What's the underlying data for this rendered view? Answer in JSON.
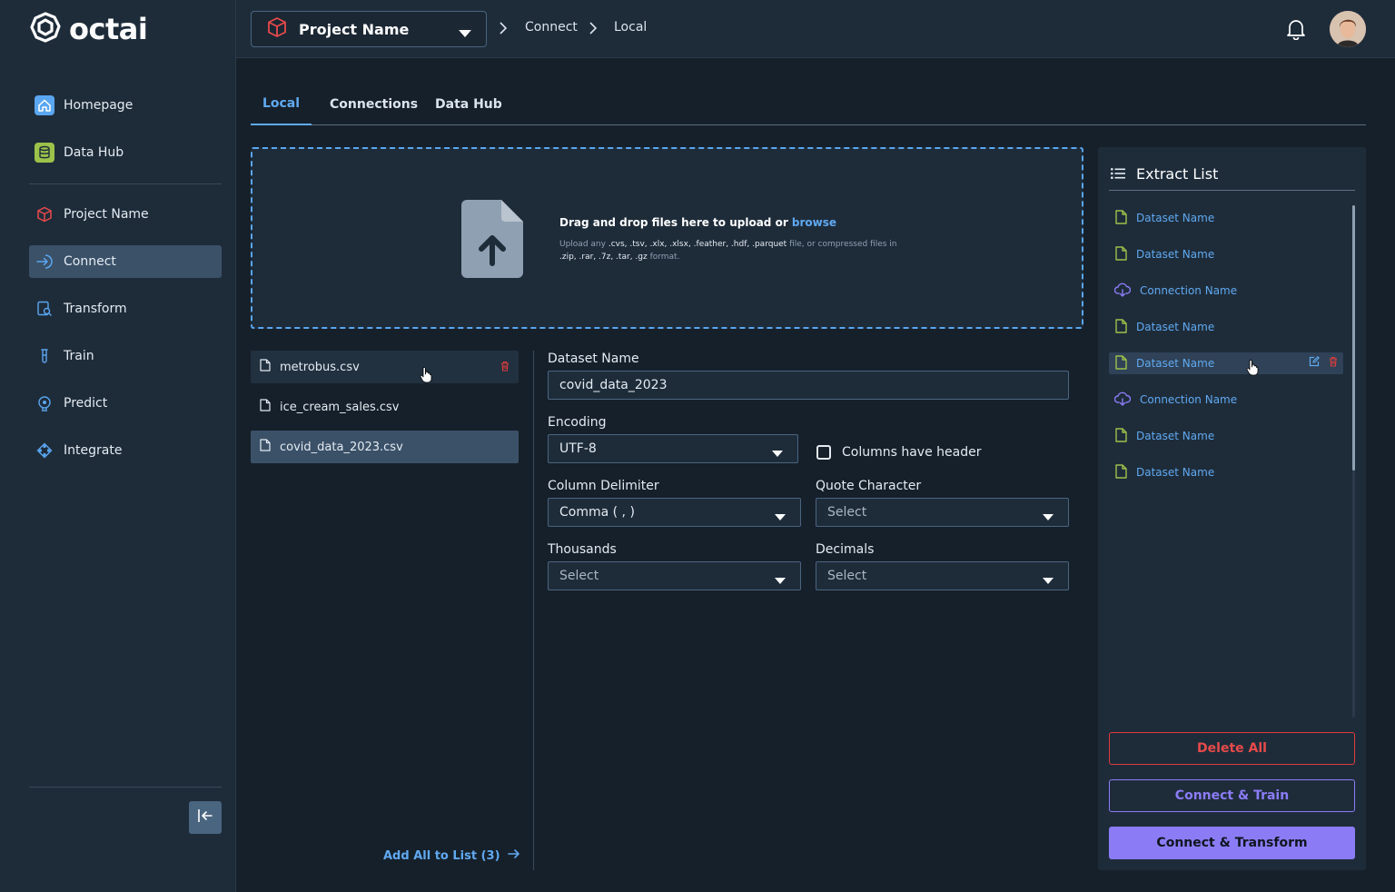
{
  "app": {
    "logo_text": "octai"
  },
  "sidebar": {
    "items": [
      {
        "label": "Homepage",
        "icon": "home-icon"
      },
      {
        "label": "Data Hub",
        "icon": "database-icon"
      },
      {
        "label": "Project Name",
        "icon": "cube-icon"
      },
      {
        "label": "Connect",
        "icon": "connect-arrow-icon",
        "active": true
      },
      {
        "label": "Transform",
        "icon": "transform-icon"
      },
      {
        "label": "Train",
        "icon": "flask-icon"
      },
      {
        "label": "Predict",
        "icon": "predict-icon"
      },
      {
        "label": "Integrate",
        "icon": "integrate-icon"
      }
    ]
  },
  "header": {
    "project_name": "Project Name",
    "breadcrumb": [
      "Connect",
      "Local"
    ]
  },
  "tabs": [
    {
      "label": "Local",
      "active": true
    },
    {
      "label": "Connections"
    },
    {
      "label": "Data Hub"
    }
  ],
  "dropzone": {
    "title": "Drag and drop files here to upload or",
    "link": "browse",
    "sub_prefix": "Upload any",
    "formats": ".cvs, .tsv, .xlx, .xlsx, .feather, .hdf, .parquet",
    "sub_middle": "file, or compressed files in",
    "compressed": ".zip, .rar, .7z, .tar, .gz",
    "sub_suffix": "format."
  },
  "files": [
    {
      "name": "metrobus.csv"
    },
    {
      "name": "ice_cream_sales.csv"
    },
    {
      "name": "covid_data_2023.csv",
      "selected": true
    }
  ],
  "add_all_label": "Add All to List (3)",
  "form": {
    "dataset_name_label": "Dataset Name",
    "dataset_name_value": "covid_data_2023",
    "encoding_label": "Encoding",
    "encoding_value": "UTF-8",
    "header_checkbox_label": "Columns have header",
    "column_delimiter_label": "Column Delimiter",
    "column_delimiter_value": "Comma ( , )",
    "quote_label": "Quote Character",
    "quote_value": "Select",
    "thousands_label": "Thousands",
    "thousands_value": "Select",
    "decimals_label": "Decimals",
    "decimals_value": "Select"
  },
  "extract_list": {
    "title": "Extract List",
    "items": [
      {
        "label": "Dataset Name",
        "type": "dataset"
      },
      {
        "label": "Dataset Name",
        "type": "dataset"
      },
      {
        "label": "Connection Name",
        "type": "connection"
      },
      {
        "label": "Dataset Name",
        "type": "dataset"
      },
      {
        "label": "Dataset Name",
        "type": "dataset",
        "selected": true
      },
      {
        "label": "Connection Name",
        "type": "connection"
      },
      {
        "label": "Dataset Name",
        "type": "dataset"
      },
      {
        "label": "Dataset Name",
        "type": "dataset"
      }
    ],
    "delete_all": "Delete All",
    "connect_train": "Connect & Train",
    "connect_transform": "Connect & Transform"
  },
  "colors": {
    "accent_blue": "#60a9f0",
    "accent_purple": "#8b7cf6",
    "danger": "#e03c3c",
    "dataset_icon": "#9cc24a",
    "connection_icon": "#8b7cf6"
  }
}
